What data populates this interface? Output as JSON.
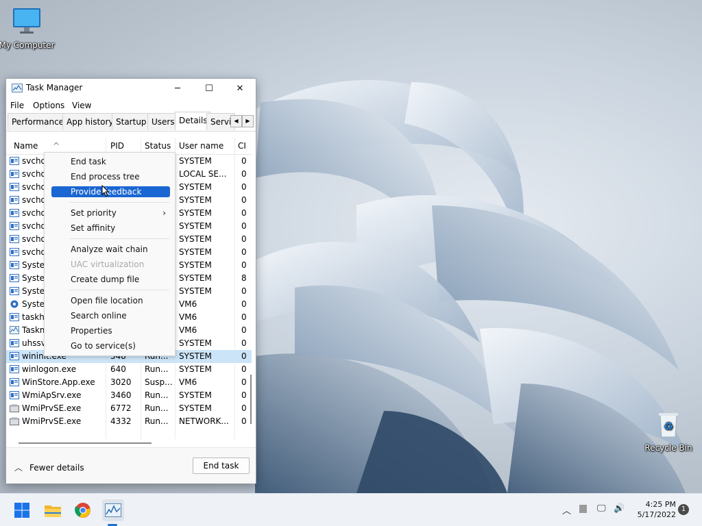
{
  "desktop": {
    "icons": {
      "my_computer": "My Computer",
      "recycle_bin": "Recycle Bin"
    }
  },
  "window": {
    "title": "Task Manager",
    "controls": {
      "minimize": "─",
      "maximize": "☐",
      "close": "✕"
    },
    "menu": [
      "File",
      "Options",
      "View"
    ],
    "tabs": [
      "Performance",
      "App history",
      "Startup",
      "Users",
      "Details",
      "Servic"
    ],
    "active_tab": "Details",
    "columns": [
      "Name",
      "PID",
      "Status",
      "User name",
      "CI"
    ],
    "rows": [
      {
        "name": "svchost.exe",
        "pid": "",
        "status": "",
        "user": "SYSTEM",
        "cpu": "0",
        "icon": "service-icon"
      },
      {
        "name": "svchost.exe",
        "pid": "",
        "status": "",
        "user": "LOCAL SE...",
        "cpu": "0",
        "icon": "service-icon"
      },
      {
        "name": "svchost.exe",
        "pid": "",
        "status": "",
        "user": "SYSTEM",
        "cpu": "0",
        "icon": "service-icon"
      },
      {
        "name": "svchost.exe",
        "pid": "",
        "status": "",
        "user": "SYSTEM",
        "cpu": "0",
        "icon": "service-icon"
      },
      {
        "name": "svchost.exe",
        "pid": "",
        "status": "",
        "user": "SYSTEM",
        "cpu": "0",
        "icon": "service-icon"
      },
      {
        "name": "svchost.exe",
        "pid": "",
        "status": "",
        "user": "SYSTEM",
        "cpu": "0",
        "icon": "service-icon"
      },
      {
        "name": "svchost.exe",
        "pid": "",
        "status": "",
        "user": "SYSTEM",
        "cpu": "0",
        "icon": "service-icon"
      },
      {
        "name": "svchost.exe",
        "pid": "",
        "status": "",
        "user": "SYSTEM",
        "cpu": "0",
        "icon": "service-icon"
      },
      {
        "name": "System",
        "pid": "",
        "status": "",
        "user": "SYSTEM",
        "cpu": "0",
        "icon": "service-icon"
      },
      {
        "name": "System",
        "pid": "",
        "status": "",
        "user": "SYSTEM",
        "cpu": "8",
        "icon": "service-icon"
      },
      {
        "name": "System",
        "pid": "",
        "status": "",
        "user": "SYSTEM",
        "cpu": "0",
        "icon": "service-icon"
      },
      {
        "name": "System",
        "pid": "",
        "status": "",
        "user": "VM6",
        "cpu": "0",
        "icon": "gear-icon"
      },
      {
        "name": "taskhostw.exe",
        "pid": "",
        "status": "",
        "user": "VM6",
        "cpu": "0",
        "icon": "service-icon"
      },
      {
        "name": "Taskmgr.exe",
        "pid": "",
        "status": "",
        "user": "VM6",
        "cpu": "0",
        "icon": "taskmgr-icon"
      },
      {
        "name": "uhssvc.exe",
        "pid": "",
        "status": "",
        "user": "SYSTEM",
        "cpu": "0",
        "icon": "service-icon"
      },
      {
        "name": "wininit.exe",
        "pid": "548",
        "status": "Run...",
        "user": "SYSTEM",
        "cpu": "0",
        "icon": "service-icon",
        "selected": true
      },
      {
        "name": "winlogon.exe",
        "pid": "640",
        "status": "Run...",
        "user": "SYSTEM",
        "cpu": "0",
        "icon": "service-icon"
      },
      {
        "name": "WinStore.App.exe",
        "pid": "3020",
        "status": "Susp...",
        "user": "VM6",
        "cpu": "0",
        "icon": "service-icon"
      },
      {
        "name": "WmiApSrv.exe",
        "pid": "3460",
        "status": "Run...",
        "user": "SYSTEM",
        "cpu": "0",
        "icon": "service-icon"
      },
      {
        "name": "WmiPrvSE.exe",
        "pid": "6772",
        "status": "Run...",
        "user": "SYSTEM",
        "cpu": "0",
        "icon": "wmi-icon"
      },
      {
        "name": "WmiPrvSE.exe",
        "pid": "4332",
        "status": "Run...",
        "user": "NETWORK...",
        "cpu": "0",
        "icon": "wmi-icon"
      }
    ],
    "footer": {
      "fewer_details": "Fewer details",
      "end_task": "End task"
    }
  },
  "context_menu": {
    "items": [
      {
        "label": "End task"
      },
      {
        "label": "End process tree"
      },
      {
        "label": "Provide feedback",
        "highlighted": true
      },
      {
        "label": "Set priority",
        "submenu": true
      },
      {
        "label": "Set affinity"
      },
      {
        "label": "Analyze wait chain"
      },
      {
        "label": "UAC virtualization",
        "disabled": true
      },
      {
        "label": "Create dump file"
      },
      {
        "label": "Open file location"
      },
      {
        "label": "Search online"
      },
      {
        "label": "Properties"
      },
      {
        "label": "Go to service(s)"
      }
    ]
  },
  "taskbar": {
    "apps": [
      "start-icon",
      "file-explorer-icon",
      "chrome-icon",
      "task-manager-icon"
    ],
    "clock": {
      "time": "4:25 PM",
      "date": "5/17/2022"
    },
    "notifications": "1"
  },
  "colors": {
    "accent": "#1a66d2",
    "selection": "#cce4f7"
  }
}
